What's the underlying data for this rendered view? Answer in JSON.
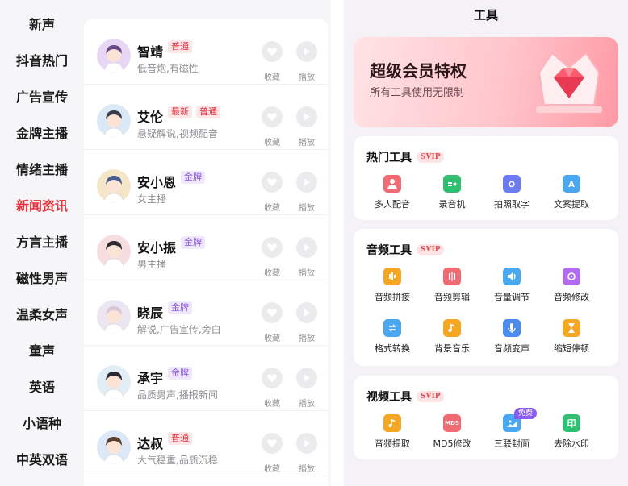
{
  "categories": [
    {
      "label": "新声",
      "active": false
    },
    {
      "label": "抖音热门",
      "active": false
    },
    {
      "label": "广告宣传",
      "active": false
    },
    {
      "label": "金牌主播",
      "active": false
    },
    {
      "label": "情绪主播",
      "active": false
    },
    {
      "label": "新闻资讯",
      "active": true
    },
    {
      "label": "方言主播",
      "active": false
    },
    {
      "label": "磁性男声",
      "active": false
    },
    {
      "label": "温柔女声",
      "active": false
    },
    {
      "label": "童声",
      "active": false
    },
    {
      "label": "英语",
      "active": false
    },
    {
      "label": "小语种",
      "active": false
    },
    {
      "label": "中英双语",
      "active": false
    }
  ],
  "voices": [
    {
      "name": "智靖",
      "tags": [
        {
          "text": "普通",
          "color": "red"
        }
      ],
      "desc": "低音炮,有磁性"
    },
    {
      "name": "艾伦",
      "tags": [
        {
          "text": "最新",
          "color": "red"
        },
        {
          "text": "普通",
          "color": "red"
        }
      ],
      "desc": "悬疑解说,视频配音"
    },
    {
      "name": "安小恩",
      "tags": [
        {
          "text": "金牌",
          "color": "purple"
        }
      ],
      "desc": "女主播"
    },
    {
      "name": "安小振",
      "tags": [
        {
          "text": "金牌",
          "color": "purple"
        }
      ],
      "desc": "男主播"
    },
    {
      "name": "晓辰",
      "tags": [
        {
          "text": "金牌",
          "color": "purple"
        }
      ],
      "desc": "解说,广告宣传,旁白"
    },
    {
      "name": "承宇",
      "tags": [
        {
          "text": "金牌",
          "color": "purple"
        }
      ],
      "desc": "品质男声,播报新闻"
    },
    {
      "name": "达叔",
      "tags": [
        {
          "text": "普通",
          "color": "red"
        }
      ],
      "desc": "大气稳重,品质沉稳"
    }
  ],
  "actions": {
    "favorite": "收藏",
    "play": "播放"
  },
  "tools_page": {
    "title": "工具",
    "vip_banner": {
      "title": "超级会员特权",
      "subtitle": "所有工具使用无限制"
    },
    "svip_badge": "SVIP",
    "sections": [
      {
        "title": "热门工具",
        "items": [
          {
            "label": "多人配音",
            "icon": "users-icon",
            "color": "#f06b73"
          },
          {
            "label": "录音机",
            "icon": "radio-icon",
            "color": "#2fbf71"
          },
          {
            "label": "拍照取字",
            "icon": "camera-icon",
            "color": "#6a7cf0"
          },
          {
            "label": "文案提取",
            "icon": "text-extract-icon",
            "color": "#4aa8f0"
          }
        ]
      },
      {
        "title": "音频工具",
        "items": [
          {
            "label": "音频拼接",
            "icon": "audio-join-icon",
            "color": "#f5a623"
          },
          {
            "label": "音频剪辑",
            "icon": "audio-cut-icon",
            "color": "#f06b73"
          },
          {
            "label": "音量调节",
            "icon": "volume-icon",
            "color": "#4aa8f0"
          },
          {
            "label": "音频修改",
            "icon": "audio-edit-icon",
            "color": "#b16cf0"
          },
          {
            "label": "格式转换",
            "icon": "format-convert-icon",
            "color": "#4aa8f0"
          },
          {
            "label": "背景音乐",
            "icon": "music-icon",
            "color": "#f5a623"
          },
          {
            "label": "音频变声",
            "icon": "mic-icon",
            "color": "#4a8cf0"
          },
          {
            "label": "缩短停顿",
            "icon": "hourglass-icon",
            "color": "#f5a623"
          }
        ]
      },
      {
        "title": "视频工具",
        "items": [
          {
            "label": "音频提取",
            "icon": "audio-extract-icon",
            "color": "#f5a623"
          },
          {
            "label": "MD5修改",
            "icon": "md5-icon",
            "color": "#f06b73",
            "glyph": "MD5"
          },
          {
            "label": "三联封面",
            "icon": "image-icon",
            "color": "#4aa8f0",
            "badge": "免费"
          },
          {
            "label": "去除水印",
            "icon": "watermark-icon",
            "color": "#2fbf71",
            "glyph": "印"
          }
        ]
      }
    ]
  }
}
